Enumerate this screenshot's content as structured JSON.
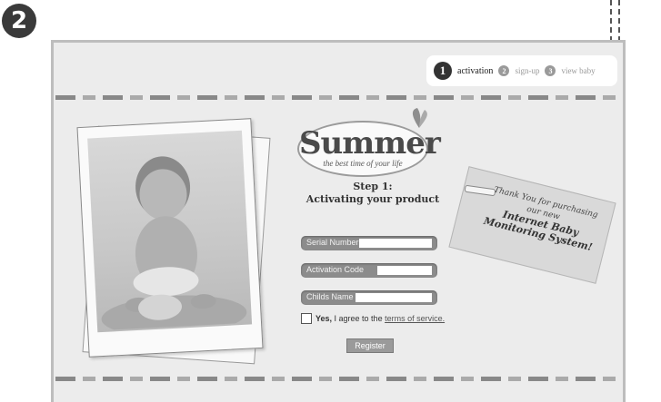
{
  "step_badge": "2",
  "progress": {
    "steps": [
      {
        "num": "1",
        "label": "activation"
      },
      {
        "num": "2",
        "label": "sign-up"
      },
      {
        "num": "3",
        "label": "view baby"
      }
    ]
  },
  "logo": {
    "word": "Summer",
    "tagline": "the best time of your life"
  },
  "step": {
    "line1": "Step 1:",
    "line2": "Activating your product"
  },
  "form": {
    "serial_label": "Serial Number",
    "activation_label": "Activation Code",
    "child_label": "Childs Name",
    "agree_prefix": "Yes,",
    "agree_text": " I agree to the ",
    "terms_link": "terms of service.",
    "register_label": "Register"
  },
  "tag": {
    "line1": "Thank You for purchasing",
    "line2": "our new",
    "line3": "Internet Baby",
    "line4": "Monitoring System!"
  },
  "colors": {
    "frame_bg": "#ececec",
    "field_bg": "#8c8c8c",
    "dashed_line": "#555555"
  }
}
